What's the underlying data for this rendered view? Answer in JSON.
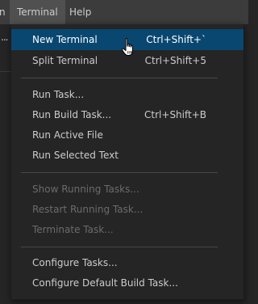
{
  "menubar": {
    "prev_menu_fragment": "n",
    "active_menu": "Terminal",
    "next_menu": "Help"
  },
  "editor": {
    "ellipsis": "..."
  },
  "terminal_menu": {
    "groups": [
      [
        {
          "label": "New Terminal",
          "shortcut": "Ctrl+Shift+`",
          "state": "highlighted"
        },
        {
          "label": "Split Terminal",
          "shortcut": "Ctrl+Shift+5",
          "state": "enabled"
        }
      ],
      [
        {
          "label": "Run Task...",
          "shortcut": "",
          "state": "enabled"
        },
        {
          "label": "Run Build Task...",
          "shortcut": "Ctrl+Shift+B",
          "state": "enabled"
        },
        {
          "label": "Run Active File",
          "shortcut": "",
          "state": "enabled"
        },
        {
          "label": "Run Selected Text",
          "shortcut": "",
          "state": "enabled"
        }
      ],
      [
        {
          "label": "Show Running Tasks...",
          "shortcut": "",
          "state": "disabled"
        },
        {
          "label": "Restart Running Task...",
          "shortcut": "",
          "state": "disabled"
        },
        {
          "label": "Terminate Task...",
          "shortcut": "",
          "state": "disabled"
        }
      ],
      [
        {
          "label": "Configure Tasks...",
          "shortcut": "",
          "state": "enabled"
        },
        {
          "label": "Configure Default Build Task...",
          "shortcut": "",
          "state": "enabled"
        }
      ]
    ]
  },
  "cursor": {
    "icon": "hand-pointer-icon"
  },
  "colors": {
    "highlight": "#094771",
    "menu_bg": "#252526",
    "menubar_bg": "#3c3c3c",
    "text": "#cccccc",
    "disabled_text": "#6b6b6b"
  }
}
